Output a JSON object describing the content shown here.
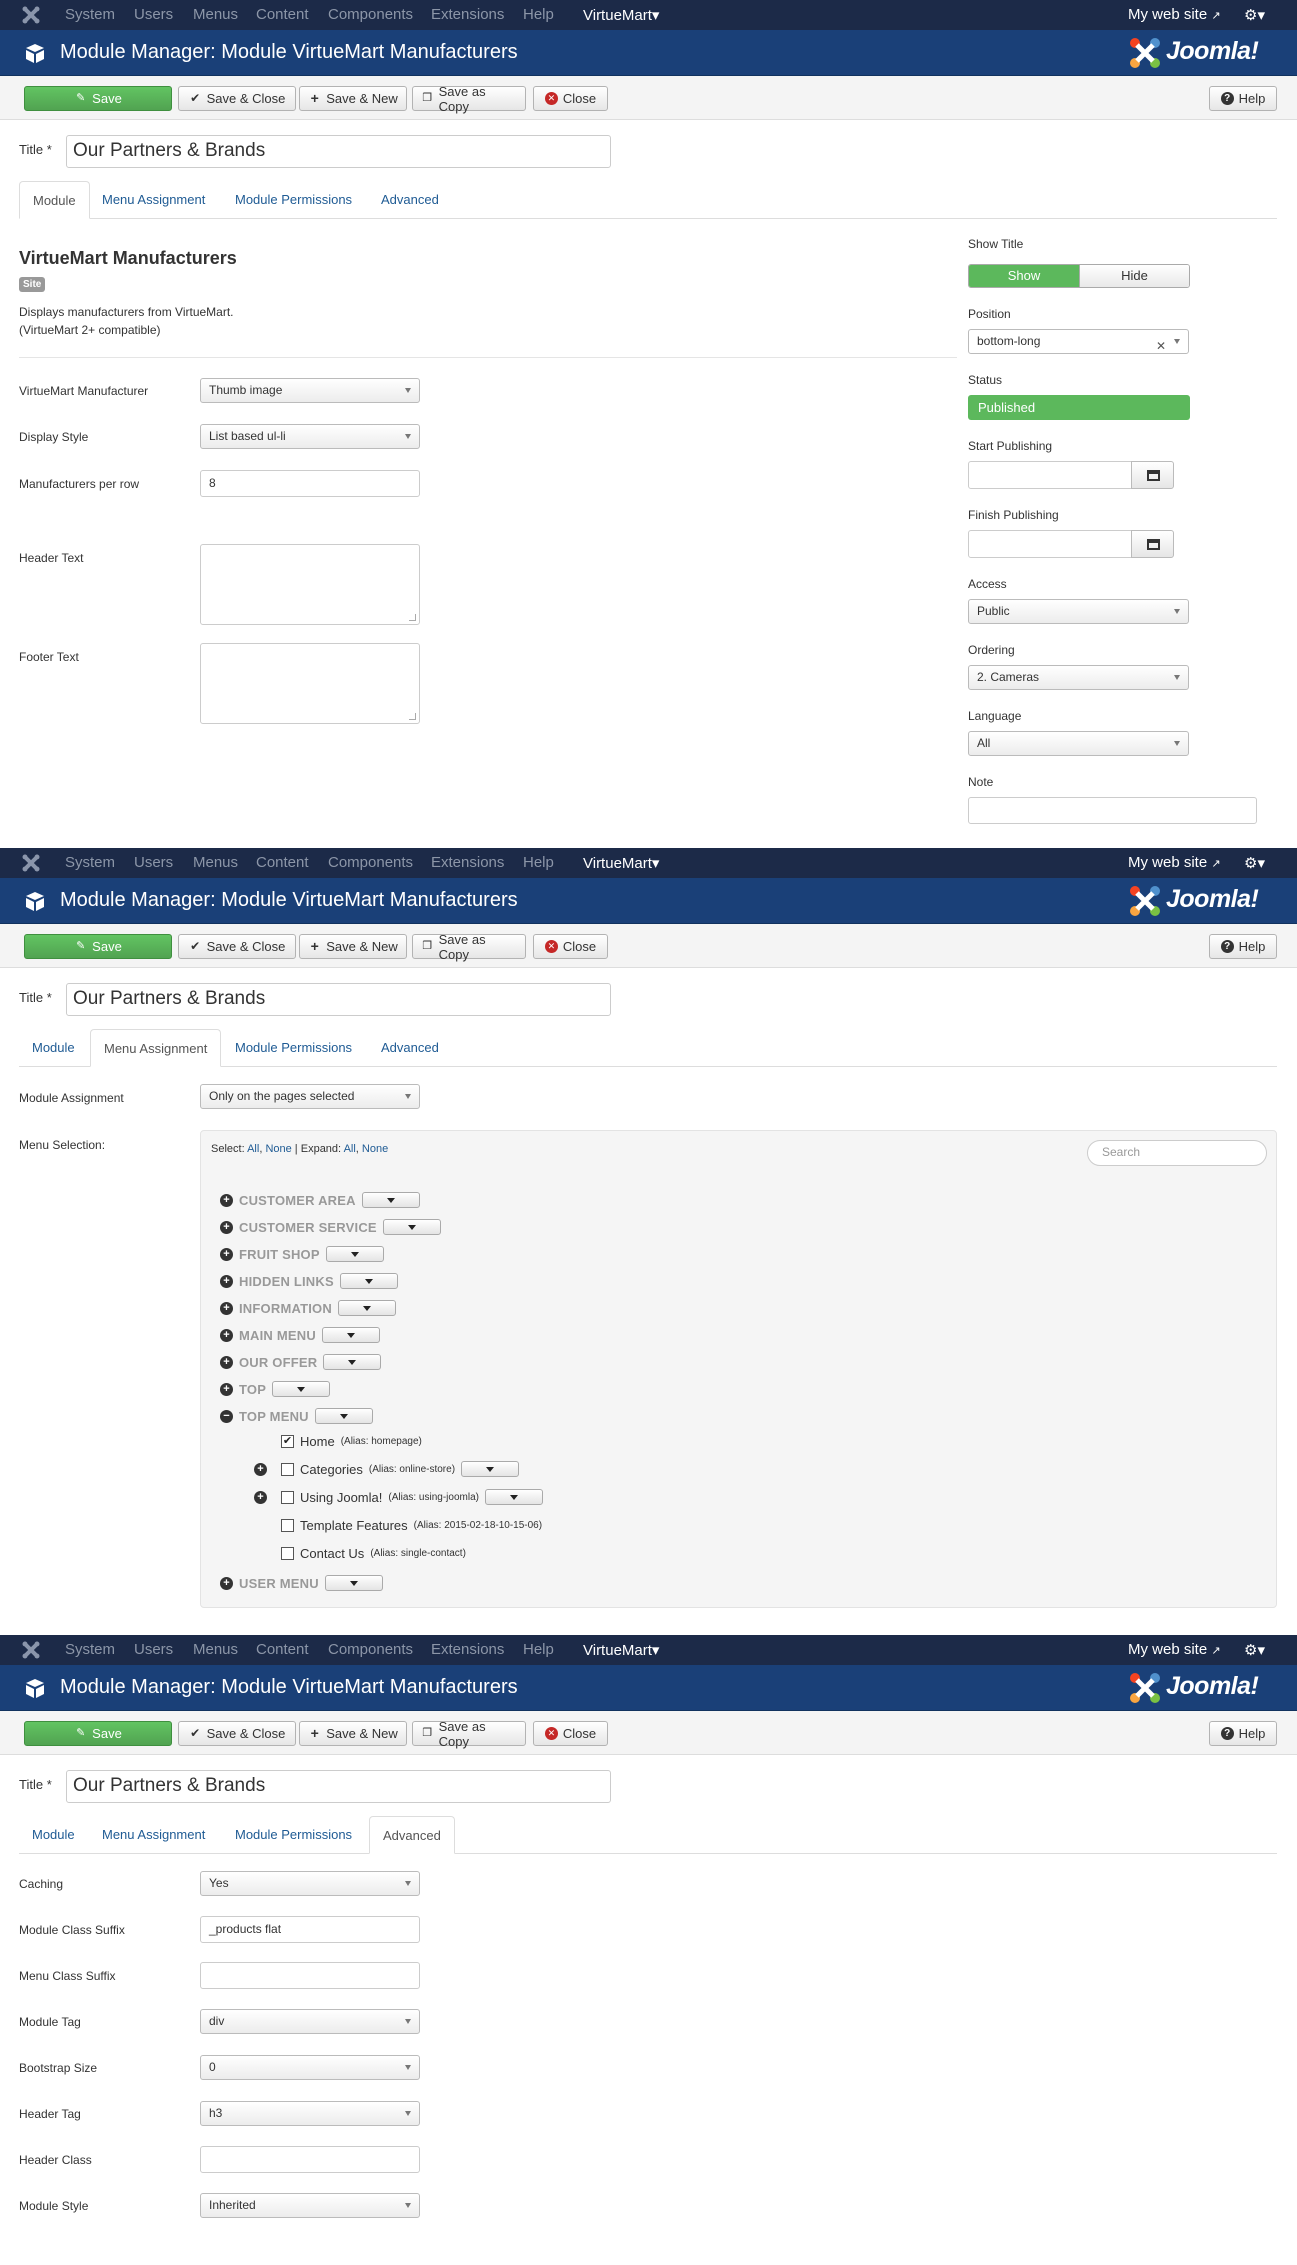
{
  "nav": {
    "items": [
      "System",
      "Users",
      "Menus",
      "Content",
      "Components",
      "Extensions",
      "Help"
    ],
    "virtuemart": "VirtueMart",
    "mysite": "My web site"
  },
  "header": {
    "title": "Module Manager: Module VirtueMart Manufacturers",
    "brand": "Joomla!"
  },
  "toolbar": {
    "save": "Save",
    "save_close": "Save & Close",
    "save_new": "Save & New",
    "save_copy": "Save as Copy",
    "close": "Close",
    "help": "Help"
  },
  "title_label": "Title *",
  "title_value": "Our Partners & Brands",
  "tabs": [
    "Module",
    "Menu Assignment",
    "Module Permissions",
    "Advanced"
  ],
  "module": {
    "heading": "VirtueMart Manufacturers",
    "badge": "Site",
    "desc1": "Displays manufacturers from VirtueMart.",
    "desc2": "(VirtueMart 2+ compatible)",
    "fields": [
      {
        "label": "VirtueMart Manufacturer",
        "value": "Thumb image"
      },
      {
        "label": "Display Style",
        "value": "List based ul-li"
      },
      {
        "label": "Manufacturers per row",
        "value": "8"
      },
      {
        "label": "Header Text",
        "value": ""
      },
      {
        "label": "Footer Text",
        "value": ""
      }
    ]
  },
  "side": {
    "show_title": "Show Title",
    "show": "Show",
    "hide": "Hide",
    "position": "Position",
    "position_value": "bottom-long",
    "status": "Status",
    "status_value": "Published",
    "start": "Start Publishing",
    "finish": "Finish Publishing",
    "access": "Access",
    "access_value": "Public",
    "ordering": "Ordering",
    "ordering_value": "2. Cameras",
    "language": "Language",
    "language_value": "All",
    "note": "Note"
  },
  "assignment": {
    "label": "Module Assignment",
    "value": "Only on the pages selected",
    "menu_label": "Menu Selection:",
    "select": "Select:",
    "all": "All",
    "none": "None",
    "expand": "Expand:",
    "search": "Search",
    "menus": [
      "CUSTOMER AREA",
      "CUSTOMER SERVICE",
      "FRUIT SHOP",
      "HIDDEN LINKS",
      "INFORMATION",
      "MAIN MENU",
      "OUR OFFER",
      "TOP",
      "TOP MENU"
    ],
    "items": [
      {
        "label": "Home",
        "alias": "(Alias: homepage)",
        "checked": true,
        "expand": false
      },
      {
        "label": "Categories",
        "alias": "(Alias: online-store)",
        "checked": false,
        "expand": true
      },
      {
        "label": "Using Joomla!",
        "alias": "(Alias: using-joomla)",
        "checked": false,
        "expand": true
      },
      {
        "label": "Template Features",
        "alias": "(Alias: 2015-02-18-10-15-06)",
        "checked": false,
        "expand": false
      },
      {
        "label": "Contact Us",
        "alias": "(Alias: single-contact)",
        "checked": false,
        "expand": false
      }
    ],
    "last_menu": "USER MENU"
  },
  "advanced": [
    {
      "label": "Caching",
      "value": "Yes",
      "kind": "select"
    },
    {
      "label": "Module Class Suffix",
      "value": "_products flat",
      "kind": "input"
    },
    {
      "label": "Menu Class Suffix",
      "value": "",
      "kind": "input"
    },
    {
      "label": "Module Tag",
      "value": "div",
      "kind": "select"
    },
    {
      "label": "Bootstrap Size",
      "value": "0",
      "kind": "select"
    },
    {
      "label": "Header Tag",
      "value": "h3",
      "kind": "select"
    },
    {
      "label": "Header Class",
      "value": "",
      "kind": "input"
    },
    {
      "label": "Module Style",
      "value": "Inherited",
      "kind": "select"
    }
  ],
  "colors": {
    "navbar": "#1c2a48",
    "header": "#1a4078",
    "green": "#5cb85c",
    "link": "#1f5b94"
  }
}
